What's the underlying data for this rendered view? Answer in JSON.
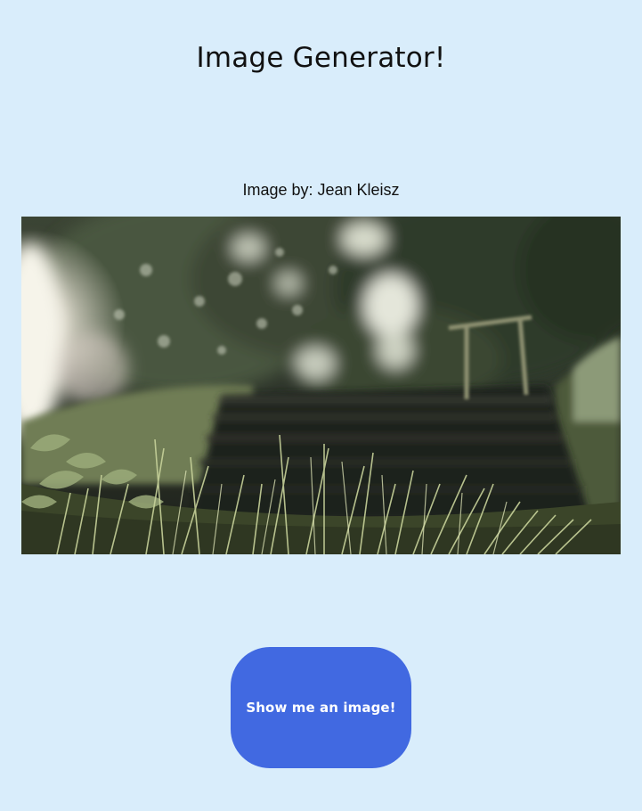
{
  "page": {
    "title": "Image Generator!",
    "background_color": "#d9edfb"
  },
  "image": {
    "credit": "Image by: Jean Kleisz",
    "alt": "Image by: Jean Kleisz"
  },
  "action": {
    "button_label": "Show me an image!",
    "button_color": "#4169e1"
  }
}
